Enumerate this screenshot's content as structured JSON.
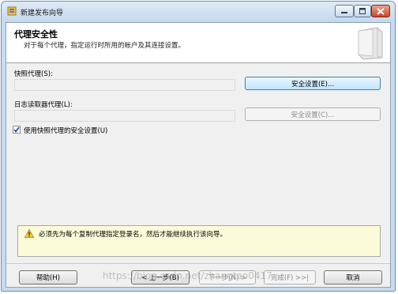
{
  "window": {
    "title": "新建发布向导",
    "minimize_icon": "minimize-icon",
    "maximize_icon": "maximize-icon",
    "close_icon": "close-icon"
  },
  "header": {
    "title": "代理安全性",
    "subtitle": "对于每个代理，指定运行时所用的帐户及其连接设置。"
  },
  "snapshot_agent": {
    "label": "快照代理(S):",
    "value": "",
    "button_label": "安全设置(E)..."
  },
  "log_reader_agent": {
    "label": "日志读取器代理(L):",
    "value": "",
    "button_label": "安全设置(C)..."
  },
  "use_snapshot_security": {
    "label": "使用快照代理的安全设置(U)",
    "checked": true
  },
  "warning": {
    "icon": "warning-icon",
    "text": "必须先为每个复制代理指定登录名，然后才能继续执行该向导。"
  },
  "footer": {
    "help_label": "帮助(H)",
    "back_label": "< 上一步(B)",
    "next_label": "下一步(N) >",
    "finish_label": "完成(F) >>|",
    "cancel_label": "取消"
  },
  "watermark": {
    "text": "https://blog.csdn.net/zhangtao0417"
  }
}
